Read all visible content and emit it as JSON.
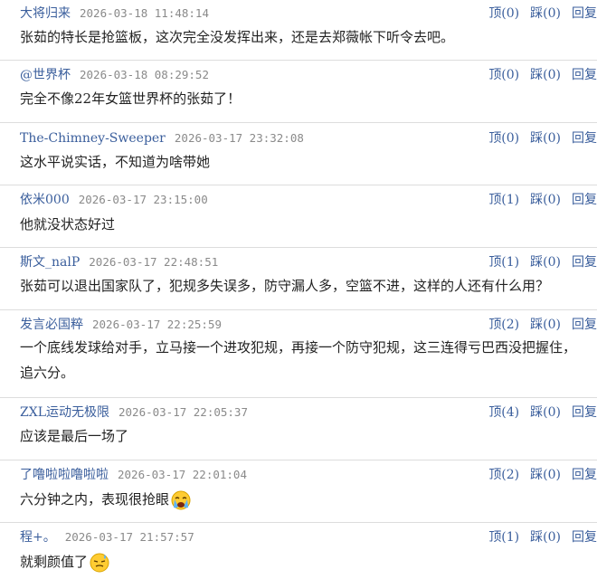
{
  "comments": [
    {
      "user": "大将归来",
      "time": "2026-03-18 11:48:14",
      "text": "张茹的特长是抢篮板，这次完全没发挥出来，还是去郑薇帐下听令去吧。",
      "actions": {
        "up": "顶(0)",
        "down": "踩(0)",
        "reply": "回复"
      }
    },
    {
      "user": "@世界杯",
      "time": "2026-03-18 08:29:52",
      "text": "完全不像22年女篮世界杯的张茹了！",
      "actions": {
        "up": "顶(0)",
        "down": "踩(0)",
        "reply": "回复"
      }
    },
    {
      "user": "The-Chimney-Sweeper",
      "time": "2026-03-17 23:32:08",
      "text": "这水平说实话，不知道为啥带她",
      "actions": {
        "up": "顶(0)",
        "down": "踩(0)",
        "reply": "回复"
      }
    },
    {
      "user": "依米000",
      "time": "2026-03-17 23:15:00",
      "text": "他就没状态好过",
      "actions": {
        "up": "顶(1)",
        "down": "踩(0)",
        "reply": "回复"
      }
    },
    {
      "user": "斯文_nalP",
      "time": "2026-03-17 22:48:51",
      "text": "张茹可以退出国家队了，犯规多失误多，防守漏人多，空篮不进，这样的人还有什么用？",
      "actions": {
        "up": "顶(1)",
        "down": "踩(0)",
        "reply": "回复"
      }
    },
    {
      "user": "发言必国粹",
      "time": "2026-03-17 22:25:59",
      "text": "一个底线发球给对手，立马接一个进攻犯规，再接一个防守犯规，这三连得亏巴西没把握住，追六分。",
      "actions": {
        "up": "顶(2)",
        "down": "踩(0)",
        "reply": "回复"
      }
    },
    {
      "user": "ZXL运动无极限",
      "time": "2026-03-17 22:05:37",
      "text": "应该是最后一场了",
      "actions": {
        "up": "顶(4)",
        "down": "踩(0)",
        "reply": "回复"
      }
    },
    {
      "user": "了噜啦啦噜啦啦",
      "time": "2026-03-17 22:01:04",
      "text": "六分钟之内，表现很抢眼",
      "emoji": "crying-face-emoji",
      "actions": {
        "up": "顶(2)",
        "down": "踩(0)",
        "reply": "回复"
      }
    },
    {
      "user": "程+。",
      "time": "2026-03-17 21:57:57",
      "text": "就剩颜值了",
      "emoji": "sweat-face-emoji",
      "actions": {
        "up": "顶(1)",
        "down": "踩(0)",
        "reply": "回复"
      }
    }
  ]
}
